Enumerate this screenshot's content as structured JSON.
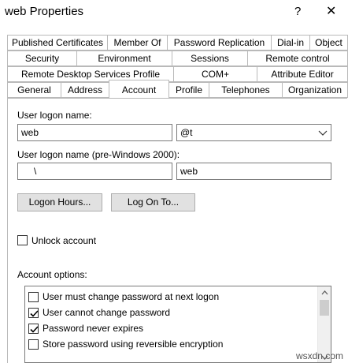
{
  "window": {
    "title": "web Properties",
    "help_label": "?",
    "close_label": "✕"
  },
  "tabs": {
    "row1": [
      "Published Certificates",
      "Member Of",
      "Password Replication",
      "Dial-in",
      "Object"
    ],
    "row2": [
      "Security",
      "Environment",
      "Sessions",
      "Remote control"
    ],
    "row3": [
      "Remote Desktop Services Profile",
      "COM+",
      "Attribute Editor"
    ],
    "row4": [
      "General",
      "Address",
      "Account",
      "Profile",
      "Telephones",
      "Organization"
    ],
    "active": "Account"
  },
  "account": {
    "logon_label": "User logon name:",
    "logon_value": "web",
    "domain_value": "@t",
    "pre2000_label": "User logon name (pre-Windows 2000):",
    "pre2000_domain": "\\",
    "pre2000_user": "web",
    "logon_hours_btn": "Logon Hours...",
    "log_on_to_btn": "Log On To...",
    "unlock_label": "Unlock account",
    "options_label": "Account options:",
    "options": [
      {
        "label": "User must change password at next logon",
        "checked": false
      },
      {
        "label": "User cannot change password",
        "checked": true
      },
      {
        "label": "Password never expires",
        "checked": true
      },
      {
        "label": "Store password using reversible encryption",
        "checked": false
      }
    ]
  },
  "watermark": "wsxdn.com"
}
